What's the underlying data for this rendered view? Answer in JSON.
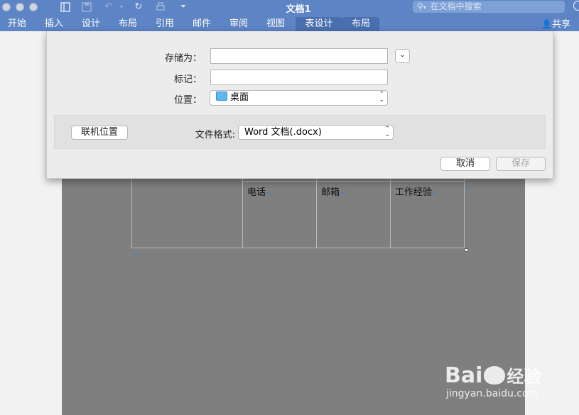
{
  "window": {
    "title": "文档1",
    "search_placeholder": "在文档中搜索"
  },
  "ribbon": {
    "tabs": [
      "开始",
      "插入",
      "设计",
      "布局",
      "引用",
      "邮件",
      "审阅",
      "视图",
      "表设计",
      "布局"
    ],
    "active_tab": "表设计",
    "share_label": "共享"
  },
  "document": {
    "table_headers": [
      "电话",
      "邮箱",
      "工作经验"
    ]
  },
  "save_dialog": {
    "save_as_label": "存储为：",
    "save_as_value": "",
    "tags_label": "标记：",
    "tags_value": "",
    "location_label": "位置：",
    "location_value": "桌面",
    "online_locations_button": "联机位置",
    "file_format_label": "文件格式:",
    "file_format_value": "Word 文档(.docx)",
    "cancel_button": "取消",
    "save_button": "保存"
  },
  "watermark": {
    "brand": "Bai",
    "brand_suffix": "经验",
    "url": "jingyan.baidu.com"
  },
  "colors": {
    "titlebar": "#5d84c4",
    "dialog_bg": "#ececec",
    "page_gray": "#7f7f7f"
  }
}
